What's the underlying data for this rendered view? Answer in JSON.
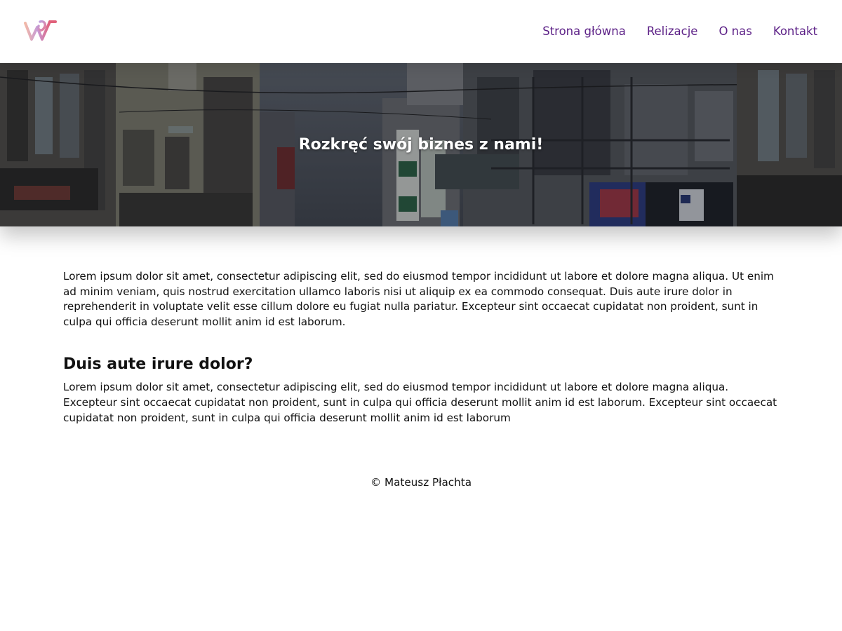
{
  "header": {
    "logo_name": "brand-logo",
    "nav": [
      {
        "label": "Strona główna"
      },
      {
        "label": "Relizacje"
      },
      {
        "label": "O nas"
      },
      {
        "label": "Kontakt"
      }
    ],
    "nav_color": "#5b1f86"
  },
  "hero": {
    "title": "Rozkręć swój biznes z nami!"
  },
  "main": {
    "intro": "Lorem ipsum dolor sit amet, consectetur adipiscing elit, sed do eiusmod tempor incididunt ut labore et dolore magna aliqua. Ut enim ad minim veniam, quis nostrud exercitation ullamco laboris nisi ut aliquip ex ea commodo consequat. Duis aute irure dolor in reprehenderit in voluptate velit esse cillum dolore eu fugiat nulla pariatur. Excepteur sint occaecat cupidatat non proident, sunt in culpa qui officia deserunt mollit anim id est laborum.",
    "section_heading": "Duis aute irure dolor?",
    "section_text": "Lorem ipsum dolor sit amet, consectetur adipiscing elit, sed do eiusmod tempor incididunt ut labore et dolore magna aliqua. Excepteur sint occaecat cupidatat non proident, sunt in culpa qui officia deserunt mollit anim id est laborum. Excepteur sint occaecat cupidatat non proident, sunt in culpa qui officia deserunt mollit anim id est laborum"
  },
  "footer": {
    "copyright": "© Mateusz Płachta"
  }
}
